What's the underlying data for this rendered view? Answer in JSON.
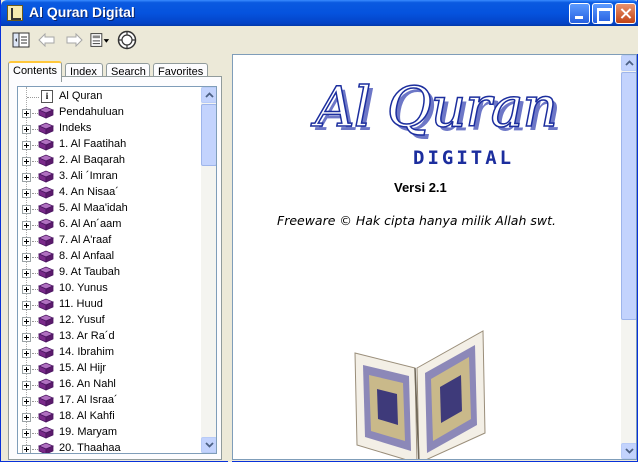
{
  "window": {
    "title": "Al Quran Digital"
  },
  "toolbar": {
    "buttons": [
      {
        "name": "hide-icon"
      },
      {
        "name": "back-icon"
      },
      {
        "name": "forward-icon"
      },
      {
        "name": "options-icon"
      },
      {
        "name": "web-help-icon"
      }
    ]
  },
  "tabs": [
    {
      "label": "Contents",
      "active": true
    },
    {
      "label": "Index",
      "active": false
    },
    {
      "label": "Search",
      "active": false
    },
    {
      "label": "Favorites",
      "active": false
    }
  ],
  "tree": {
    "items": [
      {
        "label": "Al Quran",
        "icon": "info-icon",
        "expandable": false
      },
      {
        "label": "Pendahuluan",
        "icon": "book-icon",
        "expandable": true
      },
      {
        "label": "Indeks",
        "icon": "book-icon",
        "expandable": true
      },
      {
        "label": "1. Al Faatihah",
        "icon": "book-icon",
        "expandable": true
      },
      {
        "label": "2. Al Baqarah",
        "icon": "book-icon",
        "expandable": true
      },
      {
        "label": "3. Ali ´Imran",
        "icon": "book-icon",
        "expandable": true
      },
      {
        "label": "4. An Nisaa´",
        "icon": "book-icon",
        "expandable": true
      },
      {
        "label": "5. Al Maa'idah",
        "icon": "book-icon",
        "expandable": true
      },
      {
        "label": "6. Al An´aam",
        "icon": "book-icon",
        "expandable": true
      },
      {
        "label": "7. Al A'raaf",
        "icon": "book-icon",
        "expandable": true
      },
      {
        "label": "8. Al Anfaal",
        "icon": "book-icon",
        "expandable": true
      },
      {
        "label": "9. At Taubah",
        "icon": "book-icon",
        "expandable": true
      },
      {
        "label": "10. Yunus",
        "icon": "book-icon",
        "expandable": true
      },
      {
        "label": "11. Huud",
        "icon": "book-icon",
        "expandable": true
      },
      {
        "label": "12. Yusuf",
        "icon": "book-icon",
        "expandable": true
      },
      {
        "label": "13. Ar Ra´d",
        "icon": "book-icon",
        "expandable": true
      },
      {
        "label": "14. Ibrahim",
        "icon": "book-icon",
        "expandable": true
      },
      {
        "label": "15. Al Hijr",
        "icon": "book-icon",
        "expandable": true
      },
      {
        "label": "16. An Nahl",
        "icon": "book-icon",
        "expandable": true
      },
      {
        "label": "17. Al Israa´",
        "icon": "book-icon",
        "expandable": true
      },
      {
        "label": "18. Al Kahfi",
        "icon": "book-icon",
        "expandable": true
      },
      {
        "label": "19. Maryam",
        "icon": "book-icon",
        "expandable": true
      },
      {
        "label": "20. Thaahaa",
        "icon": "book-icon",
        "expandable": true
      }
    ]
  },
  "content": {
    "logo_main": "Al Quran",
    "logo_sub": "DIGITAL",
    "version": "Versi 2.1",
    "freeware": "Freeware © Hak cipta hanya milik Allah swt."
  },
  "colors": {
    "titlebar": "#0553DE",
    "logo_blue": "#1C2E9E",
    "book_purple": "#7A2A8A"
  }
}
